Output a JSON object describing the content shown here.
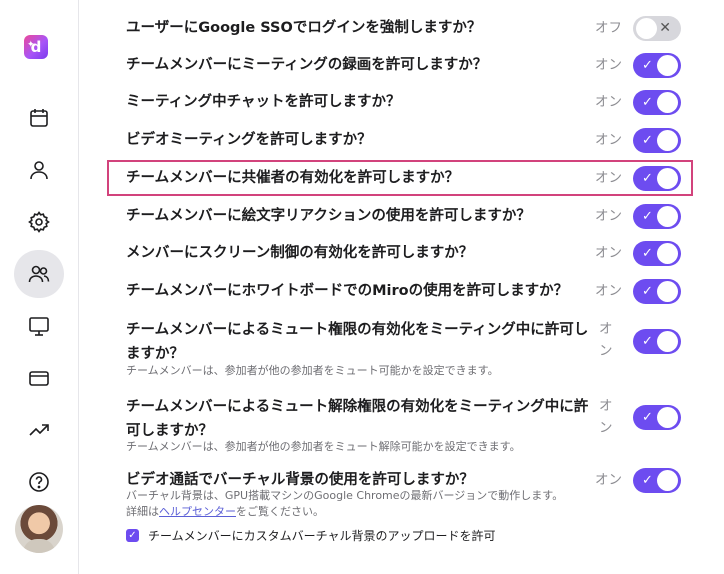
{
  "sidebar": {
    "logo_letter": "d",
    "items": [
      {
        "name": "calendar-icon"
      },
      {
        "name": "person-icon"
      },
      {
        "name": "gear-icon"
      },
      {
        "name": "people-icon",
        "active": true
      },
      {
        "name": "monitor-icon"
      },
      {
        "name": "credit-card-icon"
      },
      {
        "name": "trending-icon"
      },
      {
        "name": "help-icon"
      }
    ]
  },
  "settings": {
    "toggle_on_mark": "✓",
    "toggle_off_mark": "✕",
    "rows": [
      {
        "label": "ユーザーにGoogle SSOでログインを強制しますか？",
        "status": "オフ",
        "on": false
      },
      {
        "label": "チームメンバーにミーティングの録画を許可しますか？",
        "status": "オン",
        "on": true
      },
      {
        "label": "ミーティング中チャットを許可しますか？",
        "status": "オン",
        "on": true
      },
      {
        "label": "ビデオミーティングを許可しますか？",
        "status": "オン",
        "on": true
      },
      {
        "label": "チームメンバーに共催者の有効化を許可しますか？",
        "status": "オン",
        "on": true
      },
      {
        "label": "チームメンバーに絵文字リアクションの使用を許可しますか？",
        "status": "オン",
        "on": true
      },
      {
        "label": "メンバーにスクリーン制御の有効化を許可しますか？",
        "status": "オン",
        "on": true
      },
      {
        "label": "チームメンバーにホワイトボードでのMiroの使用を許可しますか？",
        "status": "オン",
        "on": true
      },
      {
        "label": "チームメンバーによるミュート権限の有効化をミーティング中に許可しますか？",
        "status": "オン",
        "on": true,
        "description": "チームメンバーは、参加者が他の参加者をミュート可能かを設定できます。"
      },
      {
        "label": "チームメンバーによるミュート解除権限の有効化をミーティング中に許可しますか？",
        "status": "オン",
        "on": true,
        "description": "チームメンバーは、参加者が他の参加者をミュート解除可能かを設定できます。"
      },
      {
        "label": "ビデオ通話でバーチャル背景の使用を許可しますか？",
        "status": "オン",
        "on": true,
        "description_parts": [
          "バーチャル背景は、GPU搭載マシンのGoogle Chromeの最新バージョンで動作します。詳細は",
          "ヘルプセンター",
          "をご覧ください。"
        ]
      }
    ],
    "checkbox": {
      "label": "チームメンバーにカスタムバーチャル背景のアップロードを許可",
      "checked": true
    }
  },
  "colors": {
    "accent": "#6d4cf0",
    "highlight": "#d2437c"
  }
}
